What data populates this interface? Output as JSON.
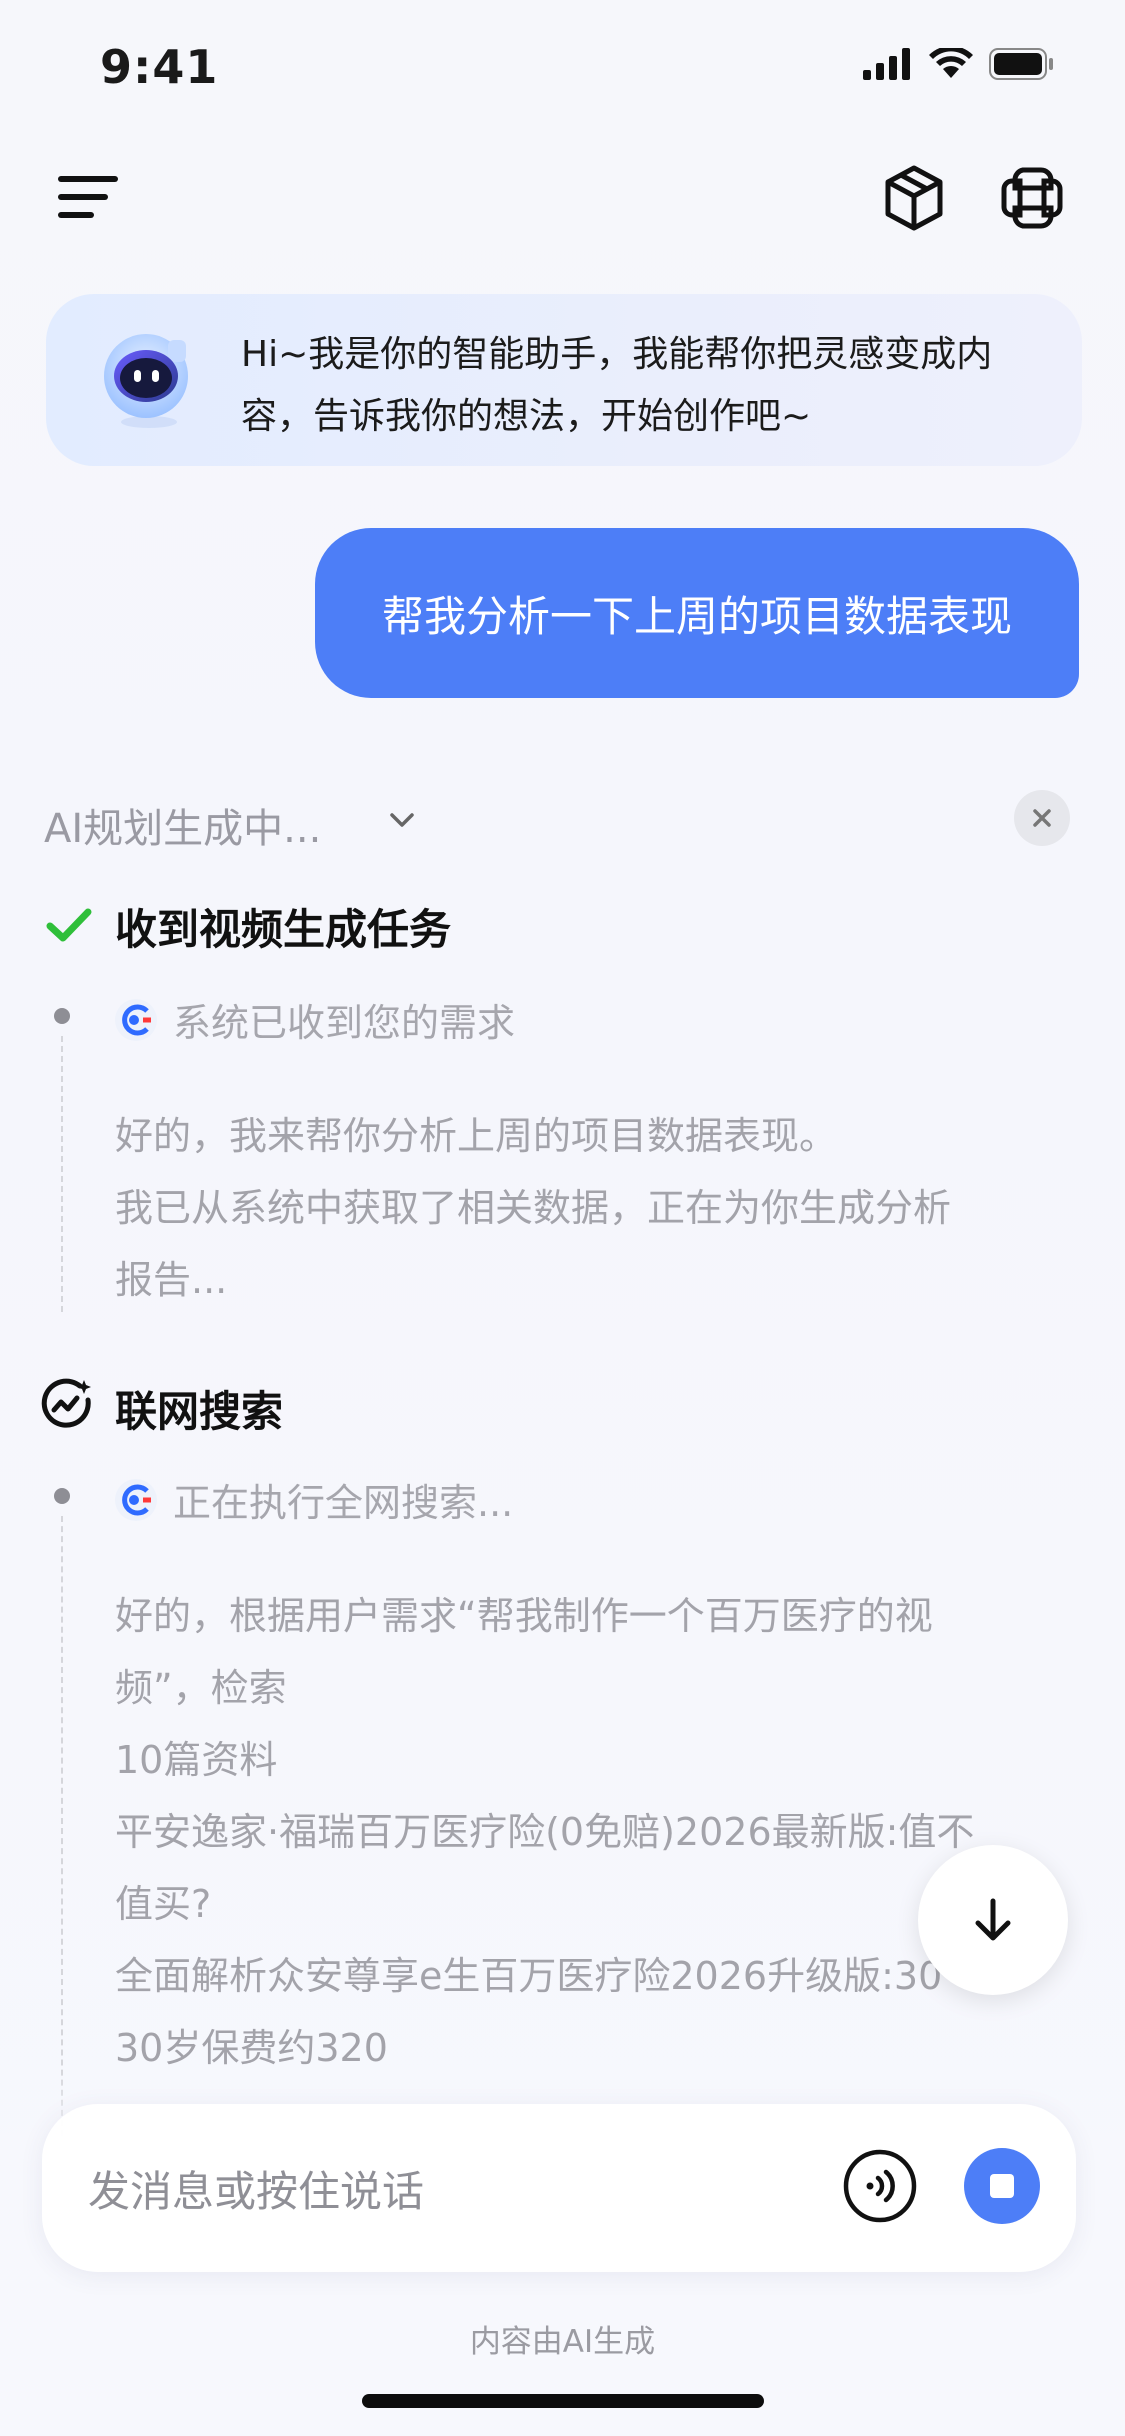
{
  "status_bar": {
    "time": "9:41"
  },
  "nav": {
    "menu_icon": "menu-icon",
    "cube_icon": "cube-icon",
    "apps_icon": "knot-icon"
  },
  "greeting": {
    "text": "Hi~我是你的智能助手，我能帮你把灵感变成内容，告诉我你的想法，开始创作吧~"
  },
  "user_message": {
    "text": "帮我分析一下上周的项目数据表现"
  },
  "planning": {
    "label": "AI规划生成中..."
  },
  "steps": [
    {
      "title": "收到视频生成任务",
      "status_icon": "check-icon",
      "sub_label": "系统已收到您的需求",
      "body_lines": [
        "好的，我来帮你分析上周的项目数据表现。",
        "我已从系统中获取了相关数据，正在为你生成分析",
        "报告..."
      ]
    },
    {
      "title": "联网搜索",
      "status_icon": "web-search-icon",
      "sub_label": "正在执行全网搜索...",
      "body_lines": [
        "好的，根据用户需求“帮我制作一个百万医疗的视",
        "频”，检索",
        "10篇资料",
        "平安逸家·福瑞百万医疗险(0免赔)2026最新版:值不",
        "值买?",
        "全面解析众安尊享e生百万医疗险2026升级版:30",
        "30岁保费约320"
      ]
    }
  ],
  "input": {
    "placeholder": "发消息或按住说话"
  },
  "footer": {
    "note": "内容由AI生成"
  },
  "colors": {
    "accent": "#4d7ef7",
    "check": "#2fbf3a"
  }
}
